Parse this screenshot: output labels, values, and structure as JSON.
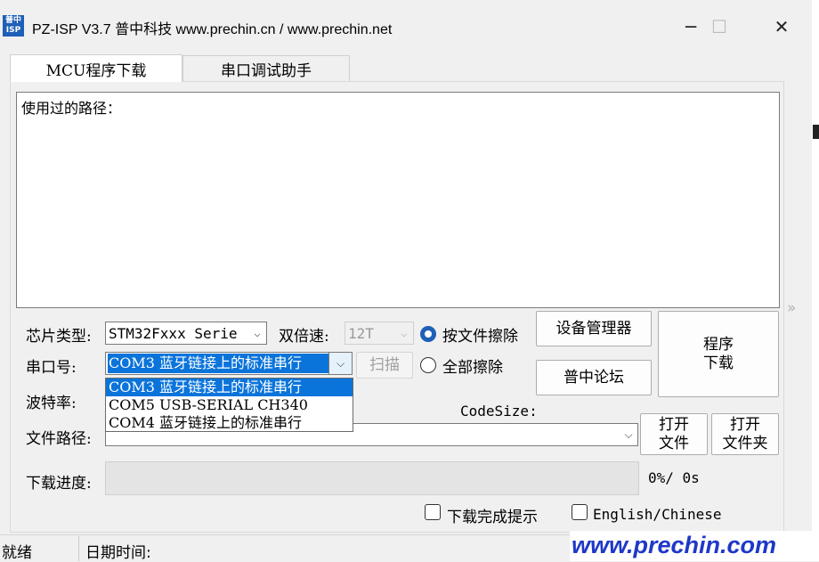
{
  "window": {
    "logo_top": "普中",
    "logo_bottom": "ISP",
    "title": "PZ-ISP V3.7 普中科技  www.prechin.cn / www.prechin.net",
    "minimize": "─",
    "maximize": "☐",
    "close": "✕"
  },
  "tabs": [
    {
      "label": "MCU程序下载"
    },
    {
      "label": "串口调试助手"
    }
  ],
  "path_area": {
    "label": "使用过的路径："
  },
  "chip": {
    "label": "芯片类型:",
    "value": "STM32Fxxx Serie"
  },
  "double_speed": {
    "label": "双倍速:",
    "value": "12T"
  },
  "erase": {
    "by_file": "按文件擦除",
    "all": "全部擦除",
    "selected": "by_file"
  },
  "buttons": {
    "device_manager": "设备管理器",
    "forum": "普中论坛",
    "download": "程序\n下载",
    "scan": "扫描",
    "open_file": "打开\n文件",
    "open_folder": "打开\n文件夹"
  },
  "port": {
    "label": "串口号:",
    "value": "COM3  蓝牙链接上的标准串行",
    "options": [
      "COM3  蓝牙链接上的标准串行",
      "COM5  USB-SERIAL CH340",
      "COM4  蓝牙链接上的标准串行"
    ],
    "selected_index": 0
  },
  "baud": {
    "label": "波特率:"
  },
  "code_size": {
    "label": "CodeSize:"
  },
  "file_path": {
    "label": "文件路径:",
    "value": ""
  },
  "progress": {
    "label": "下载进度:",
    "text": "0%/ 0s",
    "value": 0
  },
  "options": {
    "download_done_tip": "下载完成提示",
    "language": "English/Chinese"
  },
  "side_arrows": "»",
  "status": {
    "state": "就绪",
    "datetime_label": "日期时间:"
  },
  "banner": {
    "text": "www.prechin.com"
  },
  "colors": {
    "accent": "#0a74da",
    "radio_on": "#1f5fb8",
    "banner_text": "#1f38c8"
  }
}
